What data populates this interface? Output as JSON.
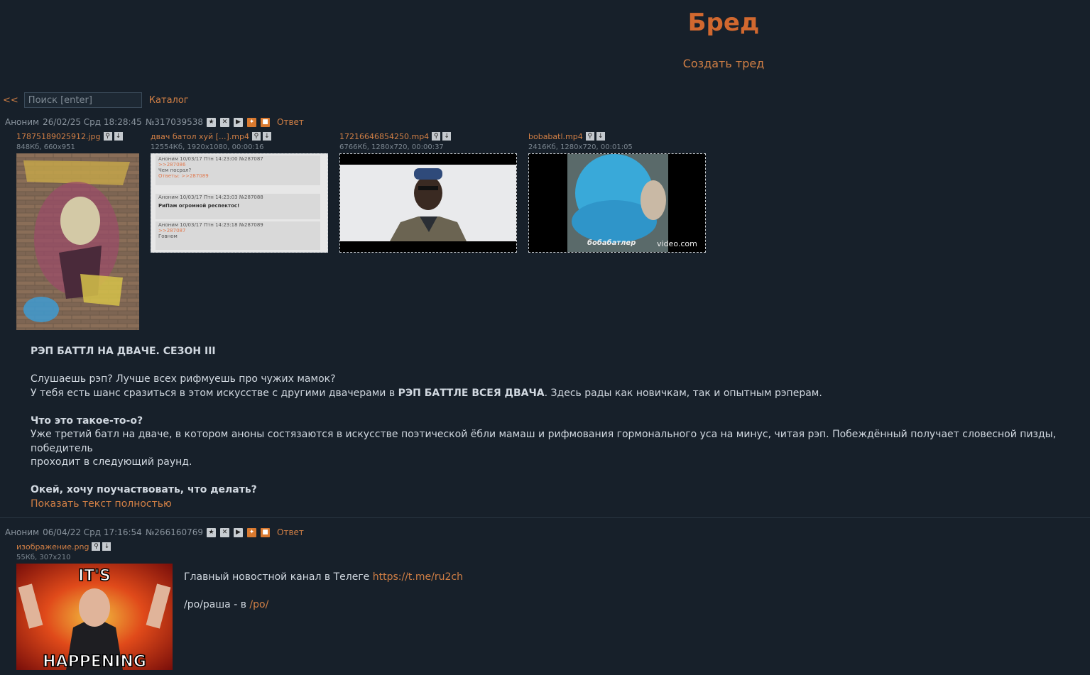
{
  "board": {
    "title": "Бред",
    "create_thread": "Создать тред"
  },
  "nav": {
    "back": "<<",
    "search_placeholder": "Поиск [enter]",
    "catalog": "Каталог"
  },
  "thread1": {
    "name": "Аноним",
    "date": "26/02/25 Срд 18:28:45",
    "num": "№317039538",
    "reply": "Ответ",
    "files": [
      {
        "name": "17875189025912.jpg",
        "meta": "848Кб, 660x951"
      },
      {
        "name": "двач батол хуй [...].mp4",
        "meta": "12554Кб, 1920x1080, 00:00:16"
      },
      {
        "name": "17216646854250.mp4",
        "meta": "6766Кб, 1280x720, 00:00:37"
      },
      {
        "name": "bobabatl.mp4",
        "meta": "2416Кб, 1280x720, 00:01:05"
      }
    ],
    "screenshot_lines": [
      "Аноним 10/03/17 Птн 14:23:00 №287087",
      ">>287086",
      "Чем посрал?",
      "Ответы: >>287089",
      "Аноним 10/03/17 Птн 14:23:03 №287088",
      "РиПам огромной респектос!",
      "Аноним 10/03/17 Птн 14:23:18 №287089",
      ">>287087",
      "Говном"
    ],
    "video_watermark": "бобабатлер",
    "video_watermark2": "video.com",
    "text": {
      "title": "РЭП БАТТЛ НА ДВАЧЕ. СЕЗОН III",
      "p1_l1": "Слушаешь рэп? Лучше всех рифмуешь про чужих мамок?",
      "p1_l2_a": "У тебя есть шанс сразиться в этом искусстве с другими двачерами в ",
      "p1_l2_b": "РЭП БАТТЛЕ ВСЕЯ ДВАЧА",
      "p1_l2_c": ". Здесь рады как новичкам, так и опытным рэперам.",
      "q1": "Что это такое-то-о?",
      "a1_l1": "Уже третий батл на дваче, в котором аноны состязаются в искусстве поэтической ёбли мамаш и рифмования гормонального уса на минус, читая рэп. Побеждённый получает словесной пизды, победитель",
      "a1_l2": "проходит в следующий раунд.",
      "q2": "Окей, хочу поучаствовать, что делать?",
      "show_full": "Показать текст полностью"
    }
  },
  "thread2": {
    "name": "Аноним",
    "date": "06/04/22 Срд 17:16:54",
    "num": "№266160769",
    "reply": "Ответ",
    "file": {
      "name": "изображение.png",
      "meta": "55Кб, 307x210"
    },
    "meme_top": "IT'S",
    "meme_bottom": "HAPPENING",
    "text": {
      "l1": "Главный новостной канал в Телеге ",
      "l1_link": "https://t.me/ru2ch",
      "l2": "/ро/раша - в ",
      "l2_link": "/po/"
    }
  },
  "colors": {
    "accent": "#d17f45",
    "title": "#d1682f",
    "background": "#17202a"
  }
}
